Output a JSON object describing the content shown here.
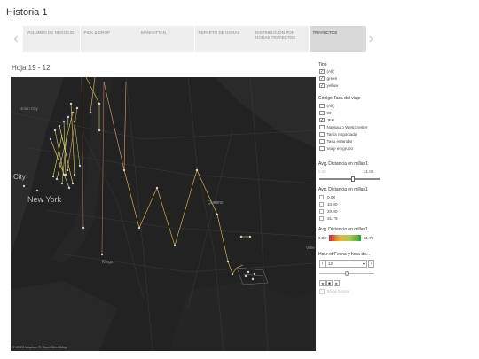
{
  "story": {
    "title": "Historia 1"
  },
  "nav": {
    "prev": "‹",
    "next": "›"
  },
  "tabs": [
    {
      "label": "VOLUMEN DE NEGOCIO",
      "active": false
    },
    {
      "label": "PICK & DROP",
      "active": false
    },
    {
      "label": "MANHATTAN",
      "active": false
    },
    {
      "label": "REPARTO DE HORAS",
      "active": false
    },
    {
      "label": "DISTRIBUCIÓN POR HORAS TRAYECTOS",
      "active": false
    },
    {
      "label": "TRAYECTOS",
      "active": true
    }
  ],
  "sheet": {
    "title": "Hoja 19 - 12"
  },
  "map": {
    "labels": {
      "union_city": "Union City",
      "city": "City",
      "new_york": "New York",
      "queens": "Queens",
      "kings": "Kings",
      "valle": "Valle"
    },
    "attribution": "© 2023 Mapbox  © OpenStreetMap"
  },
  "filters": {
    "tipo": {
      "title": "Tipo",
      "items": [
        {
          "label": "(All)",
          "checked": true
        },
        {
          "label": "green",
          "checked": true
        },
        {
          "label": "yellow",
          "checked": true
        }
      ]
    },
    "codigo": {
      "title": "Código Tasa del viaje",
      "items": [
        {
          "label": "(All)",
          "checked": false
        },
        {
          "label": "99",
          "checked": false
        },
        {
          "label": "JFK",
          "checked": true
        },
        {
          "label": "Nassau o Westchester",
          "checked": false
        },
        {
          "label": "Tarifa negociada",
          "checked": false
        },
        {
          "label": "Tasa estandar",
          "checked": false
        },
        {
          "label": "Viaje en grupo",
          "checked": false
        }
      ]
    },
    "distance_slider": {
      "title": "Avg. Distancia en millas1",
      "min": "0.00",
      "max": "31.00"
    },
    "distance_options": {
      "title": "Avg. Distancia en millas1",
      "items": [
        "0.00",
        "10.00",
        "20.00",
        "31.79"
      ]
    },
    "legend": {
      "title": "Avg. Distancia en millas1",
      "min": "0.00",
      "max": "31.79",
      "colors": [
        "#d62728",
        "#e8b23a",
        "#a7c957",
        "#2ca02c"
      ]
    },
    "hour": {
      "title": "Hour of Fecha y hora de...",
      "value": "12",
      "prev": "‹",
      "next": "›",
      "caret": "▾"
    },
    "playback": {
      "prev": "◂",
      "stop": "■",
      "play": "▸",
      "show_history": "Show history"
    }
  }
}
